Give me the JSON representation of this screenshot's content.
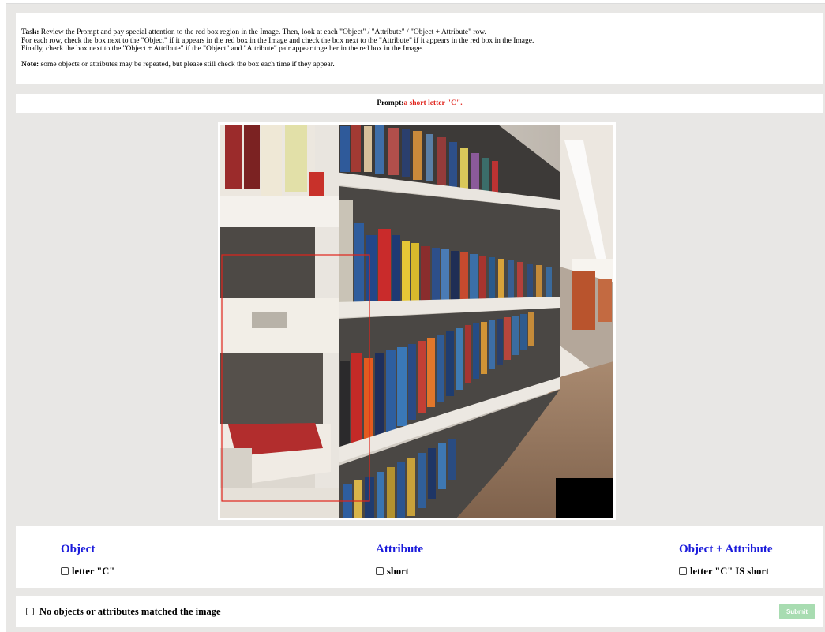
{
  "task": {
    "label": "Task:",
    "lines": [
      " Review the Prompt and pay special attention to the red box region in the Image. Then, look at each \"Object\" / \"Attribute\" / \"Object + Attribute\" row.",
      "For each row, check the box next to the \"Object\" if it appears in the red box in the Image and check the box next to the \"Attribute\" if it appears in the red box in the Image.",
      "Finally, check the box next to the \"Object + Attribute\" if the \"Object\" and \"Attribute\" pair appear together in the red box in the Image."
    ],
    "note_label": "Note:",
    "note_text": " some objects or attributes may be repeated, but please still check the box each time if they appear."
  },
  "prompt": {
    "label": "Prompt:",
    "value": "a short letter \"C\"."
  },
  "columns": {
    "object": {
      "title": "Object",
      "option": "letter \"C\""
    },
    "attribute": {
      "title": "Attribute",
      "option": "short"
    },
    "object_attribute": {
      "title": "Object + Attribute",
      "option": "letter \"C\" IS short"
    }
  },
  "footer": {
    "none_label": "No objects or attributes matched the image",
    "submit_label": "Submit"
  },
  "colors": {
    "column_title": "#1a1adb",
    "prompt_value": "#e0231b",
    "submit": "#a8dcb1",
    "highlight_box": "#e0231b"
  }
}
